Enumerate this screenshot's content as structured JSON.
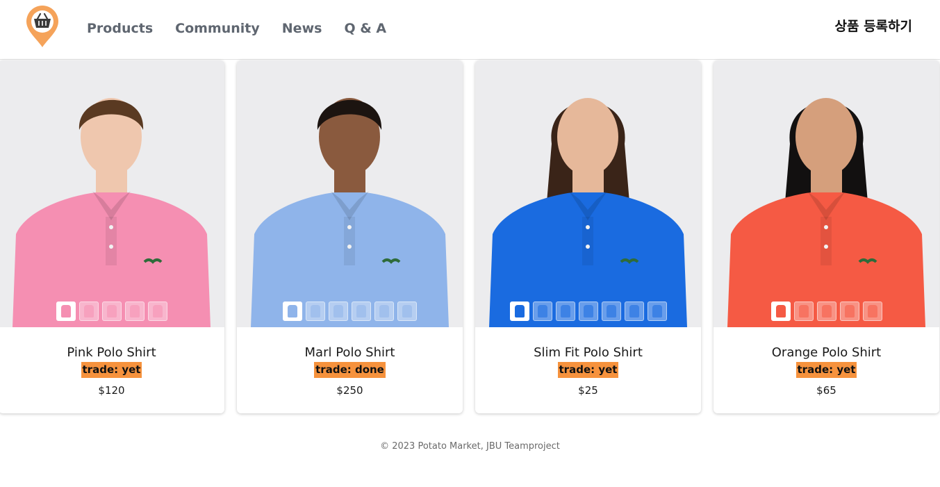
{
  "header": {
    "logo_icon": "basket-location-pin-icon",
    "nav": [
      "Products",
      "Community",
      "News",
      "Q & A"
    ],
    "register_label": "상품 등록하기"
  },
  "colors": {
    "badge": "#f6923d",
    "nav_text": "#5f6670",
    "logo": "#f5a35a"
  },
  "products": [
    {
      "name": "Pink Polo Shirt",
      "trade": "trade: yet",
      "price": "$120",
      "shirt_color": "#f58fb2",
      "thumb_count": 5,
      "active_thumb": 0
    },
    {
      "name": "Marl Polo Shirt",
      "trade": "trade: done",
      "price": "$250",
      "shirt_color": "#8fb4ea",
      "thumb_count": 6,
      "active_thumb": 0
    },
    {
      "name": "Slim Fit Polo Shirt",
      "trade": "trade: yet",
      "price": "$25",
      "shirt_color": "#1a6be0",
      "thumb_count": 7,
      "active_thumb": 0
    },
    {
      "name": "Orange Polo Shirt",
      "trade": "trade: yet",
      "price": "$65",
      "shirt_color": "#f55a44",
      "thumb_count": 5,
      "active_thumb": 0
    }
  ],
  "footer": {
    "copyright": "© 2023 Potato Market, JBU Teamproject"
  }
}
